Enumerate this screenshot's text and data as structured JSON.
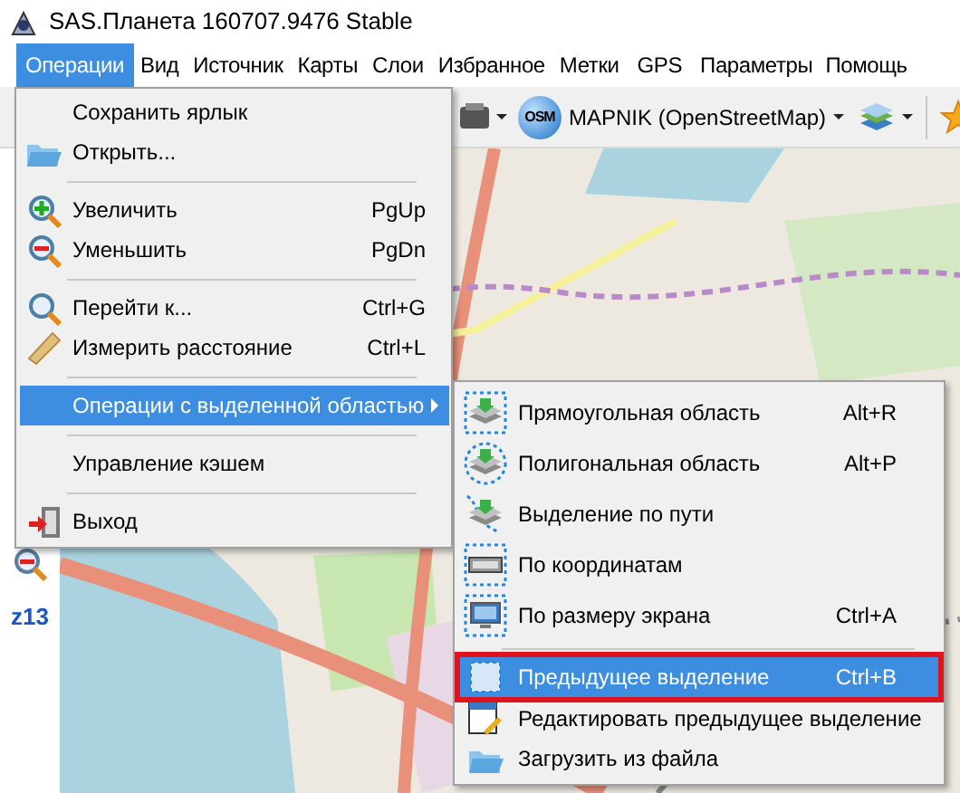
{
  "window": {
    "title": "SAS.Планета 160707.9476 Stable"
  },
  "menu_bar": [
    {
      "label": "Операции",
      "selected": true
    },
    {
      "label": "Вид",
      "selected": false
    },
    {
      "label": "Источник",
      "selected": false
    },
    {
      "label": "Карты",
      "selected": false
    },
    {
      "label": "Слои",
      "selected": false
    },
    {
      "label": "Избранное",
      "selected": false
    },
    {
      "label": "Метки",
      "selected": false
    },
    {
      "label": "GPS",
      "selected": false
    },
    {
      "label": "Параметры",
      "selected": false
    },
    {
      "label": "Помощь",
      "selected": false
    }
  ],
  "toolbar": {
    "source_badge": "OSM",
    "map_source": "MAPNIK (OpenStreetMap)"
  },
  "zoom_panel": {
    "zoom_level": "z13"
  },
  "operations_menu": [
    {
      "kind": "item",
      "label": "Сохранить ярлык",
      "selected": false
    },
    {
      "kind": "item",
      "label": "Открыть...",
      "selected": false
    },
    {
      "kind": "separator"
    },
    {
      "kind": "item",
      "label": "Увеличить",
      "shortcut": "PgUp",
      "selected": false
    },
    {
      "kind": "item",
      "label": "Уменьшить",
      "shortcut": "PgDn",
      "selected": false
    },
    {
      "kind": "separator"
    },
    {
      "kind": "item",
      "label": "Перейти к...",
      "shortcut": "Ctrl+G",
      "selected": false
    },
    {
      "kind": "item",
      "label": "Измерить расстояние",
      "shortcut": "Ctrl+L",
      "selected": false
    },
    {
      "kind": "separator"
    },
    {
      "kind": "item",
      "label": "Операции с выделенной областью",
      "submenu": true,
      "selected": true
    },
    {
      "kind": "separator"
    },
    {
      "kind": "item",
      "label": "Управление кэшем",
      "selected": false
    },
    {
      "kind": "separator"
    },
    {
      "kind": "item",
      "label": "Выход",
      "selected": false
    }
  ],
  "selection_submenu": [
    {
      "kind": "item",
      "label": "Прямоугольная область",
      "shortcut": "Alt+R",
      "selected": false,
      "outlined": false
    },
    {
      "kind": "item",
      "label": "Полигональная область",
      "shortcut": "Alt+P",
      "selected": false,
      "outlined": false
    },
    {
      "kind": "item",
      "label": "Выделение по пути",
      "selected": false,
      "outlined": false
    },
    {
      "kind": "item",
      "label": "По координатам",
      "selected": false,
      "outlined": false
    },
    {
      "kind": "item",
      "label": "По размеру экрана",
      "shortcut": "Ctrl+A",
      "selected": false,
      "outlined": false
    },
    {
      "kind": "separator"
    },
    {
      "kind": "item",
      "label": "Предыдущее выделение",
      "shortcut": "Ctrl+B",
      "selected": true,
      "outlined": true
    },
    {
      "kind": "item",
      "label": "Редактировать предыдущее выделение",
      "selected": false,
      "outlined": false
    },
    {
      "kind": "item",
      "label": "Загрузить из файла",
      "selected": false,
      "outlined": false
    }
  ]
}
